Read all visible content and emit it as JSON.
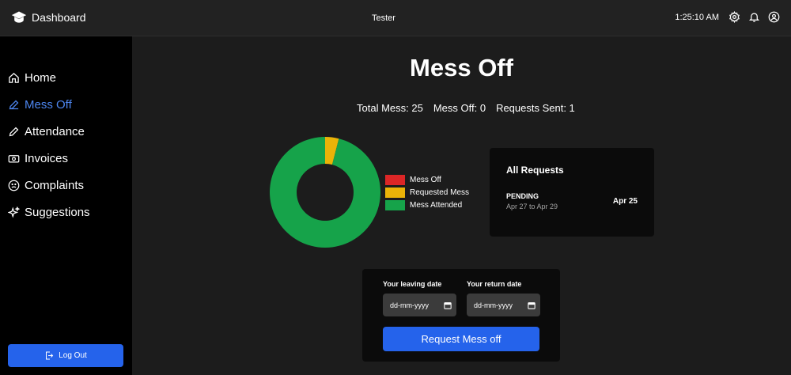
{
  "header": {
    "brand": "Dashboard",
    "brand_icon": "graduation-cap-icon",
    "user": "Tester",
    "time": "1:25:10 AM",
    "icons": [
      "gear-icon",
      "bell-icon",
      "user-circle-icon"
    ]
  },
  "sidebar": {
    "items": [
      {
        "label": "Home",
        "icon": "home-icon",
        "active": false
      },
      {
        "label": "Mess Off",
        "icon": "pencil-icon",
        "active": true
      },
      {
        "label": "Attendance",
        "icon": "pencil-icon",
        "active": false
      },
      {
        "label": "Invoices",
        "icon": "banknote-icon",
        "active": false
      },
      {
        "label": "Complaints",
        "icon": "frown-face-icon",
        "active": false
      },
      {
        "label": "Suggestions",
        "icon": "sparkles-icon",
        "active": false
      }
    ],
    "logout_label": "Log Out",
    "accent": "#4d86f0"
  },
  "main": {
    "title": "Mess Off",
    "stats": {
      "total_mess": "Total Mess: 25",
      "mess_off": "Mess Off: 0",
      "requests_sent": "Requests Sent: 1"
    }
  },
  "chart_data": {
    "type": "pie",
    "categories": [
      "Mess Off",
      "Requested Mess",
      "Mess Attended"
    ],
    "values": [
      0,
      1,
      24
    ],
    "colors": [
      "#dc2626",
      "#eab308",
      "#16a34a"
    ],
    "donut": true,
    "legend_placement": "right"
  },
  "requests": {
    "title": "All Requests",
    "items": [
      {
        "status": "PENDING",
        "range": "Apr 27 to Apr 29",
        "date": "Apr 25"
      }
    ]
  },
  "form": {
    "leaving_label": "Your leaving date",
    "return_label": "Your return date",
    "leaving_placeholder": "dd-mm-yyyy",
    "return_placeholder": "dd-mm-yyyy",
    "submit_label": "Request Mess off",
    "button_color": "#2563eb"
  }
}
